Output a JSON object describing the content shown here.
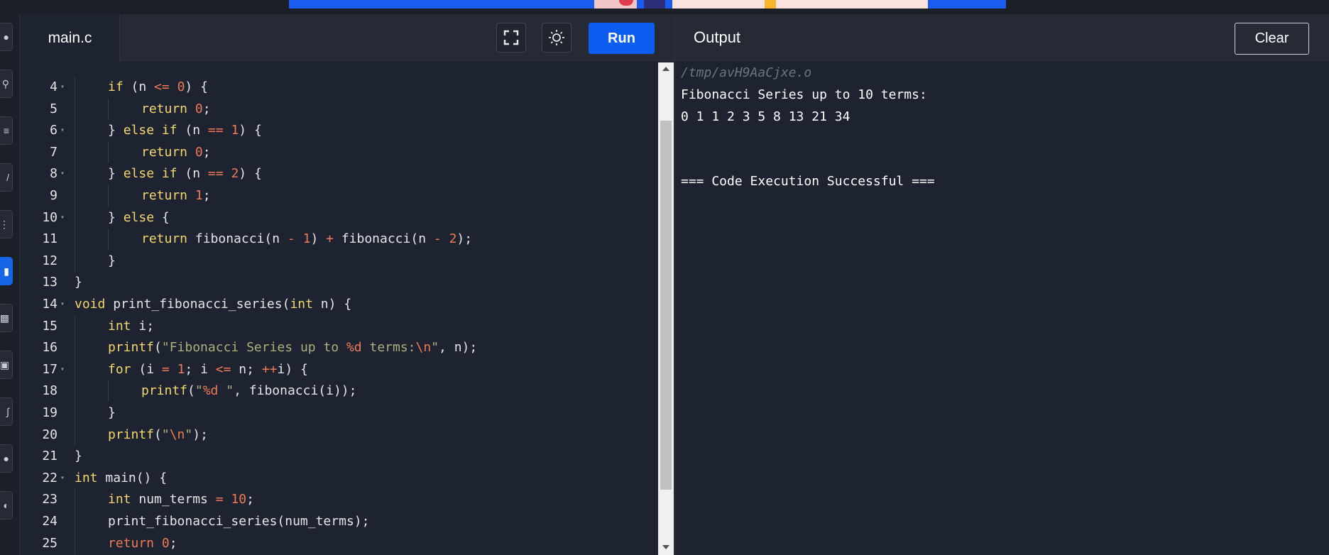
{
  "editor": {
    "file_tab": "main.c",
    "run_label": "Run",
    "icons": {
      "fullscreen": "fullscreen-icon",
      "theme": "sun-icon"
    },
    "lines": [
      {
        "n": "4",
        "fold": true,
        "indent": 1,
        "tokens": [
          [
            "kw",
            "if"
          ],
          [
            "t",
            " (n "
          ],
          [
            "op",
            "<="
          ],
          [
            "t",
            " "
          ],
          [
            "num",
            "0"
          ],
          [
            "t",
            ") {"
          ]
        ]
      },
      {
        "n": "5",
        "fold": false,
        "indent": 2,
        "tokens": [
          [
            "kw",
            "return"
          ],
          [
            "t",
            " "
          ],
          [
            "num",
            "0"
          ],
          [
            "t",
            ";"
          ]
        ]
      },
      {
        "n": "6",
        "fold": true,
        "indent": 1,
        "tokens": [
          [
            "t",
            "} "
          ],
          [
            "kw",
            "else if"
          ],
          [
            "t",
            " (n "
          ],
          [
            "op",
            "=="
          ],
          [
            "t",
            " "
          ],
          [
            "num",
            "1"
          ],
          [
            "t",
            ") {"
          ]
        ]
      },
      {
        "n": "7",
        "fold": false,
        "indent": 2,
        "tokens": [
          [
            "kw",
            "return"
          ],
          [
            "t",
            " "
          ],
          [
            "num",
            "0"
          ],
          [
            "t",
            ";"
          ]
        ]
      },
      {
        "n": "8",
        "fold": true,
        "indent": 1,
        "tokens": [
          [
            "t",
            "} "
          ],
          [
            "kw",
            "else if"
          ],
          [
            "t",
            " (n "
          ],
          [
            "op",
            "=="
          ],
          [
            "t",
            " "
          ],
          [
            "num",
            "2"
          ],
          [
            "t",
            ") {"
          ]
        ]
      },
      {
        "n": "9",
        "fold": false,
        "indent": 2,
        "tokens": [
          [
            "kw",
            "return"
          ],
          [
            "t",
            " "
          ],
          [
            "num",
            "1"
          ],
          [
            "t",
            ";"
          ]
        ]
      },
      {
        "n": "10",
        "fold": true,
        "indent": 1,
        "tokens": [
          [
            "t",
            "} "
          ],
          [
            "kw",
            "else"
          ],
          [
            "t",
            " {"
          ]
        ]
      },
      {
        "n": "11",
        "fold": false,
        "indent": 2,
        "tokens": [
          [
            "kw",
            "return"
          ],
          [
            "t",
            " fibonacci(n "
          ],
          [
            "op",
            "-"
          ],
          [
            "t",
            " "
          ],
          [
            "num",
            "1"
          ],
          [
            "t",
            ") "
          ],
          [
            "op",
            "+"
          ],
          [
            "t",
            " fibonacci(n "
          ],
          [
            "op",
            "-"
          ],
          [
            "t",
            " "
          ],
          [
            "num",
            "2"
          ],
          [
            "t",
            ");"
          ]
        ]
      },
      {
        "n": "12",
        "fold": false,
        "indent": 1,
        "tokens": [
          [
            "t",
            "}"
          ]
        ]
      },
      {
        "n": "13",
        "fold": false,
        "indent": 0,
        "tokens": [
          [
            "t",
            "}"
          ]
        ]
      },
      {
        "n": "14",
        "fold": true,
        "indent": 0,
        "tokens": [
          [
            "kw",
            "void"
          ],
          [
            "t",
            " print_fibonacci_series("
          ],
          [
            "kw",
            "int"
          ],
          [
            "t",
            " n) {"
          ]
        ]
      },
      {
        "n": "15",
        "fold": false,
        "indent": 1,
        "tokens": [
          [
            "kw",
            "int"
          ],
          [
            "t",
            " i;"
          ]
        ]
      },
      {
        "n": "16",
        "fold": false,
        "indent": 1,
        "tokens": [
          [
            "kw",
            "printf"
          ],
          [
            "t",
            "("
          ],
          [
            "str",
            "\"Fibonacci Series up to "
          ],
          [
            "esc",
            "%d"
          ],
          [
            "str",
            " terms:"
          ],
          [
            "esc",
            "\\n"
          ],
          [
            "str",
            "\""
          ],
          [
            "t",
            ", n);"
          ]
        ]
      },
      {
        "n": "17",
        "fold": true,
        "indent": 1,
        "tokens": [
          [
            "kw",
            "for"
          ],
          [
            "t",
            " (i "
          ],
          [
            "op",
            "="
          ],
          [
            "t",
            " "
          ],
          [
            "num",
            "1"
          ],
          [
            "t",
            "; i "
          ],
          [
            "op",
            "<="
          ],
          [
            "t",
            " n; "
          ],
          [
            "op",
            "++"
          ],
          [
            "t",
            "i) {"
          ]
        ]
      },
      {
        "n": "18",
        "fold": false,
        "indent": 2,
        "tokens": [
          [
            "kw",
            "printf"
          ],
          [
            "t",
            "("
          ],
          [
            "str",
            "\""
          ],
          [
            "esc",
            "%d"
          ],
          [
            "str",
            " \""
          ],
          [
            "t",
            ", fibonacci(i));"
          ]
        ]
      },
      {
        "n": "19",
        "fold": false,
        "indent": 1,
        "tokens": [
          [
            "t",
            "}"
          ]
        ]
      },
      {
        "n": "20",
        "fold": false,
        "indent": 1,
        "tokens": [
          [
            "kw",
            "printf"
          ],
          [
            "t",
            "("
          ],
          [
            "str",
            "\""
          ],
          [
            "esc",
            "\\n"
          ],
          [
            "str",
            "\""
          ],
          [
            "t",
            ");"
          ]
        ]
      },
      {
        "n": "21",
        "fold": false,
        "indent": 0,
        "tokens": [
          [
            "t",
            "}"
          ]
        ]
      },
      {
        "n": "22",
        "fold": true,
        "indent": 0,
        "tokens": [
          [
            "kw",
            "int"
          ],
          [
            "t",
            " main() {"
          ]
        ]
      },
      {
        "n": "23",
        "fold": false,
        "indent": 1,
        "tokens": [
          [
            "kw",
            "int"
          ],
          [
            "t",
            " num_terms "
          ],
          [
            "op",
            "="
          ],
          [
            "t",
            " "
          ],
          [
            "num",
            "10"
          ],
          [
            "t",
            ";"
          ]
        ]
      },
      {
        "n": "24",
        "fold": false,
        "indent": 1,
        "tokens": [
          [
            "t",
            "print_fibonacci_series(num_terms);"
          ]
        ]
      },
      {
        "n": "25",
        "fold": false,
        "indent": 1,
        "tokens": [
          [
            "num",
            "return"
          ],
          [
            "t",
            " "
          ],
          [
            "num",
            "0"
          ],
          [
            "t",
            ";"
          ]
        ]
      }
    ]
  },
  "output": {
    "title": "Output",
    "clear_label": "Clear",
    "path": "/tmp/avH9AaCjxe.o",
    "lines": [
      "Fibonacci Series up to 10 terms:",
      "0 1 1 2 3 5 8 13 21 34",
      "",
      "",
      "=== Code Execution Successful ==="
    ]
  },
  "colors": {
    "accent": "#0d5ef0",
    "keyword": "#f5d76e",
    "number": "#f07a55",
    "string": "#a6b47a",
    "background": "#1d2330"
  }
}
